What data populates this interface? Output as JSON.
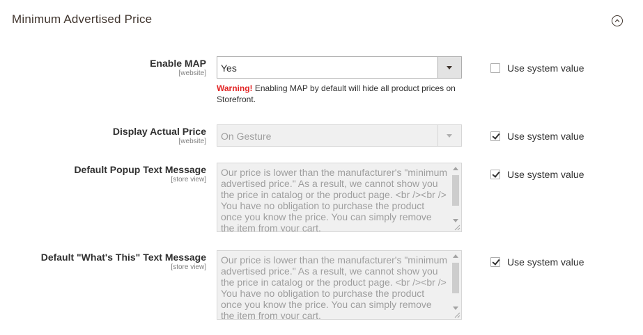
{
  "section": {
    "title": "Minimum Advertised Price"
  },
  "fields": {
    "enable_map": {
      "label": "Enable MAP",
      "scope": "[website]",
      "value": "Yes",
      "warning_prefix": "Warning!",
      "warning_text": " Enabling MAP by default will hide all product prices on Storefront.",
      "use_system_value": false
    },
    "display_actual_price": {
      "label": "Display Actual Price",
      "scope": "[website]",
      "value": "On Gesture",
      "use_system_value": true
    },
    "default_popup_text": {
      "label": "Default Popup Text Message",
      "scope": "[store view]",
      "value": "Our price is lower than the manufacturer's \"minimum advertised price.\" As a result, we cannot show you the price in catalog or the product page. <br /><br /> You have no obligation to purchase the product once you know the price. You can simply remove the item from your cart.",
      "use_system_value": true
    },
    "default_whats_this_text": {
      "label": "Default \"What's This\" Text Message",
      "scope": "[store view]",
      "value": "Our price is lower than the manufacturer's \"minimum advertised price.\" As a result, we cannot show you the price in catalog or the product page. <br /><br /> You have no obligation to purchase the product once you know the price. You can simply remove the item from your cart.",
      "use_system_value": true
    }
  },
  "use_system_value_label": "Use system value"
}
